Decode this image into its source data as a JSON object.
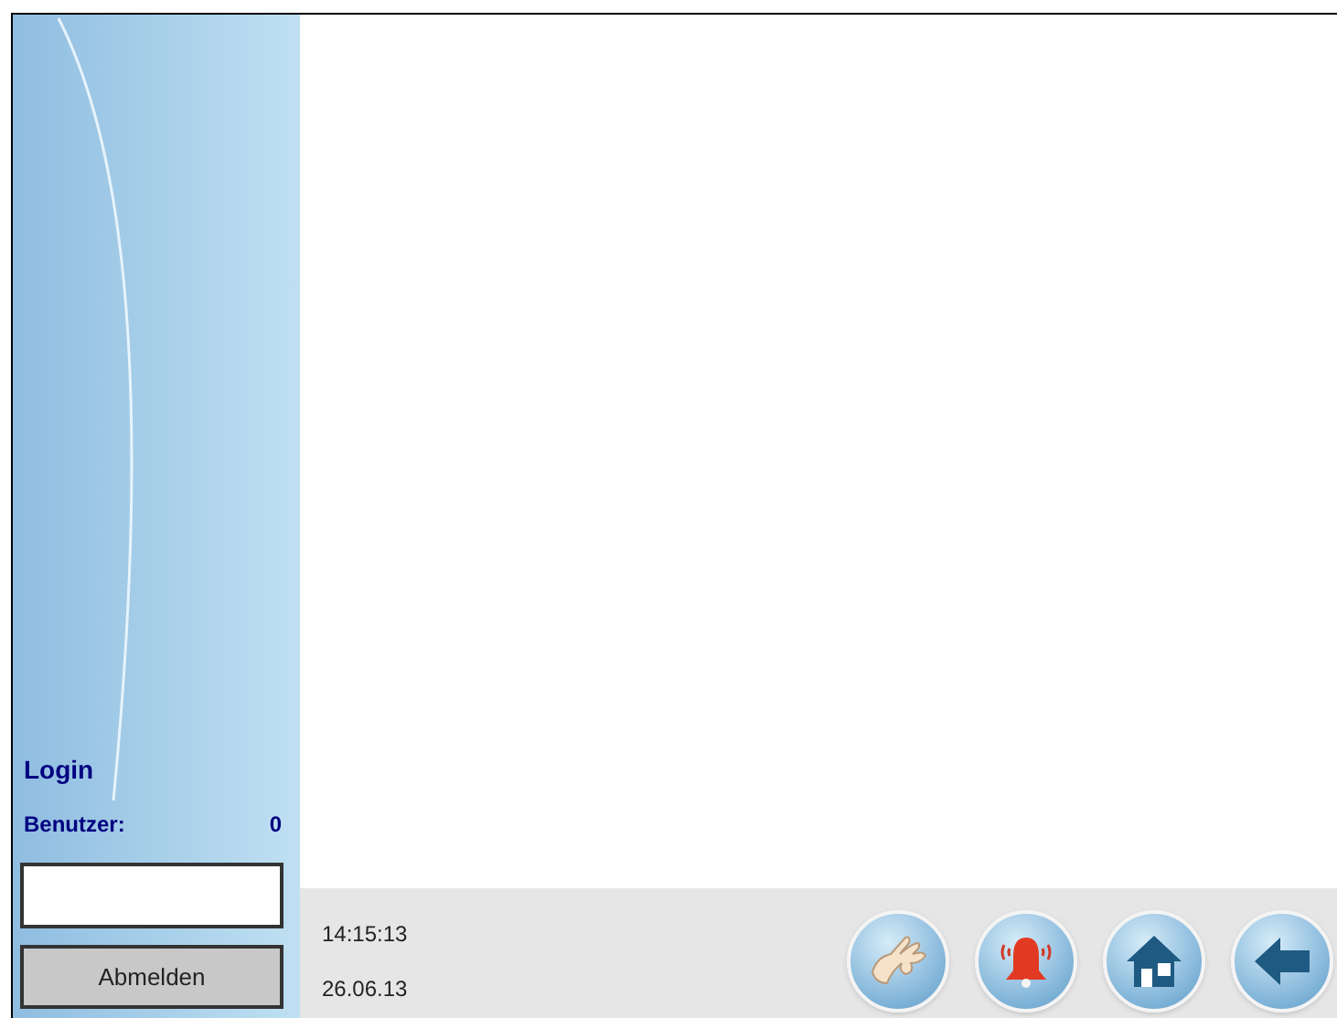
{
  "sidebar": {
    "title": "Login",
    "user_label": "Benutzer:",
    "user_count": "0",
    "logout_button": "Abmelden"
  },
  "status_bar": {
    "time": "14:15:13",
    "date": "26.06.13"
  }
}
